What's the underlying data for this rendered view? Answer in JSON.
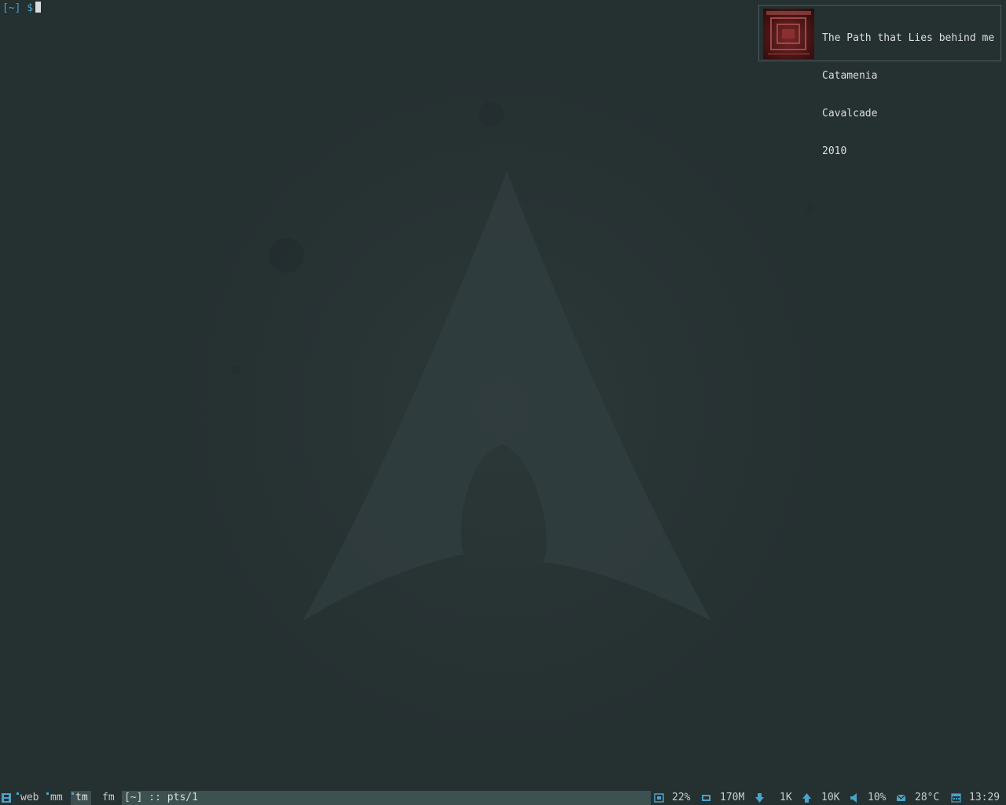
{
  "terminal": {
    "prompt": "[~] $"
  },
  "now_playing": {
    "title": "The Path that Lies behind me",
    "artist": "Catamenia",
    "album": "Cavalcade",
    "year": "2010"
  },
  "panel": {
    "tags": [
      {
        "label": "web",
        "selected": false
      },
      {
        "label": "mm",
        "selected": false
      },
      {
        "label": "tm",
        "selected": true
      },
      {
        "label": "fm",
        "selected": false
      }
    ],
    "task_title": "[~] :: pts/1",
    "cpu": "22%",
    "memory": "170M",
    "net_down": "1K",
    "net_up": "10K",
    "volume": "10%",
    "temperature": "28°C",
    "clock": "13:29"
  },
  "colors": {
    "accent": "#4aa3c9",
    "background": "#253031",
    "panel_highlight": "#3e5151"
  },
  "icons": [
    "menu-icon",
    "cpu-icon",
    "memory-icon",
    "download-arrow-icon",
    "upload-arrow-icon",
    "speaker-icon",
    "mail-icon",
    "calendar-icon"
  ]
}
